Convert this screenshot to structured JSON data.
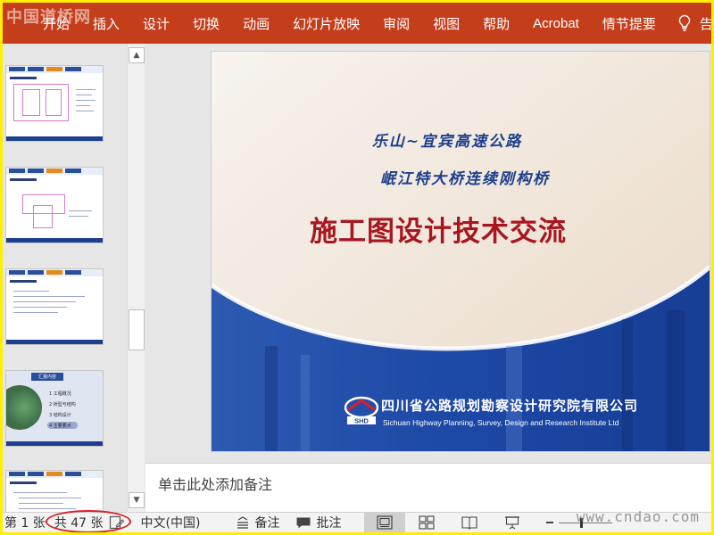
{
  "watermark_top": "中国道桥网",
  "ribbon": {
    "tabs": [
      "开始",
      "插入",
      "设计",
      "切换",
      "动画",
      "幻灯片放映",
      "审阅",
      "视图",
      "帮助",
      "Acrobat",
      "情节提要"
    ],
    "tell_me": "告诉"
  },
  "slide": {
    "subtitle1": "乐山~宜宾高速公路",
    "subtitle2": "岷江特大桥连续刚构桥",
    "main_title": "施工图设计技术交流",
    "company_cn": "四川省公路规划勘察设计研究院有限公司",
    "company_en": "Sichuan Highway Planning, Survey, Design and Research Institute Ltd",
    "logo_text": "SHD"
  },
  "thumb4": {
    "title": "汇报内容",
    "items": [
      "1  工程概况",
      "2  桥型与结构",
      "3  结构设计",
      "4  主要要点"
    ]
  },
  "notes": {
    "placeholder": "单击此处添加备注"
  },
  "status": {
    "slide_indicator": "第 1 张",
    "total": "共 47 张",
    "language": "中文(中国)",
    "notes_label": "备注",
    "comments_label": "批注"
  },
  "site_watermark": "www.cndao.com",
  "colors": {
    "ribbon": "#c43e1c",
    "slide_blue": "#1d3f8d",
    "title_red": "#a8161f",
    "highlight_circle": "#d8202a",
    "frame_yellow": "#ffee00"
  }
}
